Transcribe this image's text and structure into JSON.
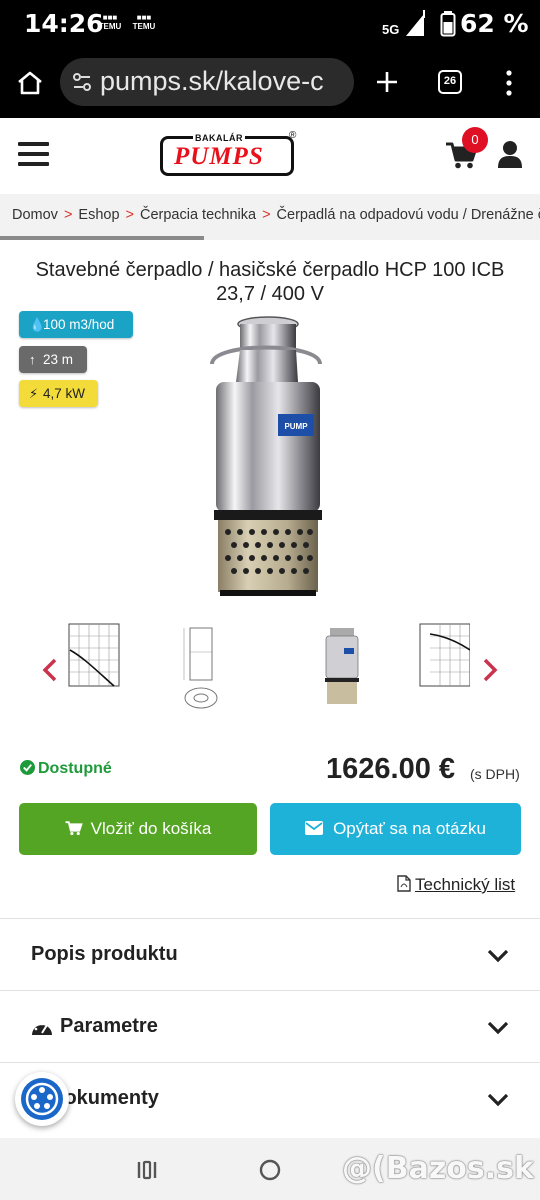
{
  "status_bar": {
    "time": "14:26",
    "notif_app_1": "TEMU",
    "notif_app_2": "TEMU",
    "network": "5G",
    "battery": "62 %"
  },
  "browser": {
    "url": "pumps.sk/kalove-c",
    "tab_count": "26",
    "icons": [
      "home-icon",
      "site-settings-icon",
      "new-tab-icon",
      "tabs-icon",
      "menu-icon"
    ]
  },
  "site_header": {
    "logo_top": "BAKALÁR",
    "logo_main": "PUMPS",
    "logo_mark": "®",
    "cart_count": "0"
  },
  "breadcrumb": {
    "items": [
      "Domov",
      "Eshop",
      "Čerpacia technika",
      "Čerpadlá na odpadovú vodu / Drenážne čerpadlá"
    ],
    "separator": ">"
  },
  "product": {
    "title_line1": "Stavebné čerpadlo / hasičské čerpadlo HCP 100 ICB",
    "title_line2": "23,7 / 400 V",
    "badges": [
      {
        "icon": "drop-icon",
        "text": "100 m3/hod",
        "color": "#1aa3c4"
      },
      {
        "icon": "arrow-up-icon",
        "text": "23 m",
        "color": "#6a6a6a"
      },
      {
        "icon": "bolt-icon",
        "text": "4,7 kW",
        "color": "#f3dc3a"
      }
    ],
    "image_label": "PUMP",
    "availability": "Dostupné",
    "price": "1626.00 €",
    "vat_note": "(s DPH)",
    "add_to_cart": "Vložiť do košíka",
    "ask_question": "Opýtať sa na otázku",
    "tech_sheet": "Technický list"
  },
  "accordion": [
    {
      "label": "Popis produktu"
    },
    {
      "label": "Parametre"
    },
    {
      "label": "Dokumenty"
    }
  ],
  "watermark": "@(Bazos.sk",
  "colors": {
    "primary_green": "#55a524",
    "primary_blue": "#1fb2d9",
    "accent_red": "#e01024",
    "availability_green": "#1e9a3a"
  }
}
